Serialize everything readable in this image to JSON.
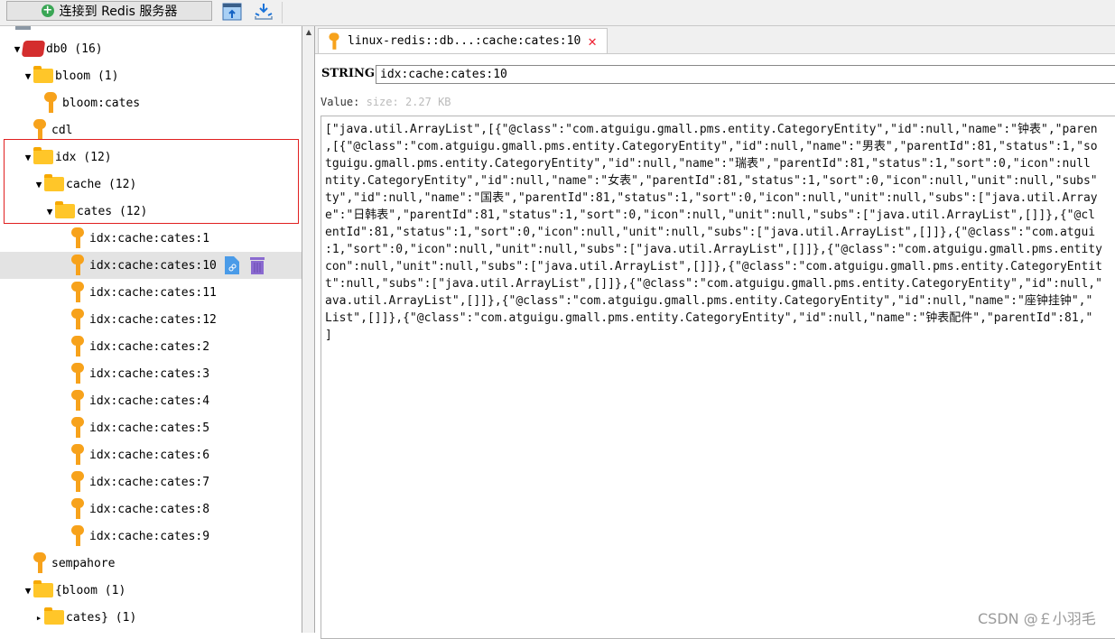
{
  "toolbar": {
    "connect_label": "连接到 Redis 服务器",
    "import_icon": "import-icon",
    "export_icon": "export-icon"
  },
  "tree": [
    {
      "label": "db0  (16)",
      "type": "db",
      "level": 0,
      "expanded": true
    },
    {
      "label": "bloom (1)",
      "type": "folder",
      "level": 1,
      "expanded": true
    },
    {
      "label": "bloom:cates",
      "type": "key",
      "level": 2
    },
    {
      "label": "cdl",
      "type": "key",
      "level": 1
    },
    {
      "label": "idx (12)",
      "type": "folder",
      "level": 1,
      "expanded": true
    },
    {
      "label": "cache (12)",
      "type": "folder",
      "level": 2,
      "expanded": true
    },
    {
      "label": "cates (12)",
      "type": "folder",
      "level": 3,
      "expanded": true
    },
    {
      "label": "idx:cache:cates:1",
      "type": "key",
      "level": 4
    },
    {
      "label": "idx:cache:cates:10",
      "type": "key",
      "level": 4,
      "selected": true
    },
    {
      "label": "idx:cache:cates:11",
      "type": "key",
      "level": 4
    },
    {
      "label": "idx:cache:cates:12",
      "type": "key",
      "level": 4
    },
    {
      "label": "idx:cache:cates:2",
      "type": "key",
      "level": 4
    },
    {
      "label": "idx:cache:cates:3",
      "type": "key",
      "level": 4
    },
    {
      "label": "idx:cache:cates:4",
      "type": "key",
      "level": 4
    },
    {
      "label": "idx:cache:cates:5",
      "type": "key",
      "level": 4
    },
    {
      "label": "idx:cache:cates:6",
      "type": "key",
      "level": 4
    },
    {
      "label": "idx:cache:cates:7",
      "type": "key",
      "level": 4
    },
    {
      "label": "idx:cache:cates:8",
      "type": "key",
      "level": 4
    },
    {
      "label": "idx:cache:cates:9",
      "type": "key",
      "level": 4
    },
    {
      "label": "sempahore",
      "type": "key",
      "level": 1
    },
    {
      "label": "{bloom (1)",
      "type": "folder",
      "level": 1,
      "expanded": true
    },
    {
      "label": "cates} (1)",
      "type": "folder",
      "level": 2,
      "expanded": false
    }
  ],
  "tab": {
    "title": "linux-redis::db...:cache:cates:10"
  },
  "editor": {
    "type_label": "STRING:",
    "key_name": "idx:cache:cates:10",
    "value_label": "Value:",
    "size": "size: 2.27 KB",
    "value_lines": [
      "[\"java.util.ArrayList\",[{\"@class\":\"com.atguigu.gmall.pms.entity.CategoryEntity\",\"id\":null,\"name\":\"钟表\",\"paren",
      ",[{\"@class\":\"com.atguigu.gmall.pms.entity.CategoryEntity\",\"id\":null,\"name\":\"男表\",\"parentId\":81,\"status\":1,\"so",
      "tguigu.gmall.pms.entity.CategoryEntity\",\"id\":null,\"name\":\"瑞表\",\"parentId\":81,\"status\":1,\"sort\":0,\"icon\":null",
      "ntity.CategoryEntity\",\"id\":null,\"name\":\"女表\",\"parentId\":81,\"status\":1,\"sort\":0,\"icon\":null,\"unit\":null,\"subs\"",
      "ty\",\"id\":null,\"name\":\"国表\",\"parentId\":81,\"status\":1,\"sort\":0,\"icon\":null,\"unit\":null,\"subs\":[\"java.util.Array",
      "e\":\"日韩表\",\"parentId\":81,\"status\":1,\"sort\":0,\"icon\":null,\"unit\":null,\"subs\":[\"java.util.ArrayList\",[]]},{\"@cl",
      "entId\":81,\"status\":1,\"sort\":0,\"icon\":null,\"unit\":null,\"subs\":[\"java.util.ArrayList\",[]]},{\"@class\":\"com.atgui",
      ":1,\"sort\":0,\"icon\":null,\"unit\":null,\"subs\":[\"java.util.ArrayList\",[]]},{\"@class\":\"com.atguigu.gmall.pms.entity",
      "con\":null,\"unit\":null,\"subs\":[\"java.util.ArrayList\",[]]},{\"@class\":\"com.atguigu.gmall.pms.entity.CategoryEntit",
      "t\":null,\"subs\":[\"java.util.ArrayList\",[]]},{\"@class\":\"com.atguigu.gmall.pms.entity.CategoryEntity\",\"id\":null,\"",
      "ava.util.ArrayList\",[]]},{\"@class\":\"com.atguigu.gmall.pms.entity.CategoryEntity\",\"id\":null,\"name\":\"座钟挂钟\",\"",
      "List\",[]]},{\"@class\":\"com.atguigu.gmall.pms.entity.CategoryEntity\",\"id\":null,\"name\":\"钟表配件\",\"parentId\":81,\"",
      "]"
    ]
  },
  "watermark": "CSDN @￡小羽毛",
  "colors": {
    "highlight_box": "#e02020",
    "key_icon": "#f7a21b",
    "folder": "#ffc629",
    "selected_row": "#e3e3e3"
  }
}
